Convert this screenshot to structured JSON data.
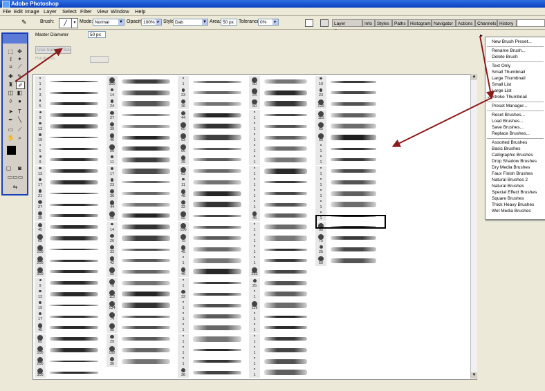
{
  "window": {
    "title": "Adobe Photoshop"
  },
  "menubar": {
    "items": [
      "File",
      "Edit",
      "Image",
      "Layer",
      "Select",
      "Filter",
      "View",
      "Window",
      "Help"
    ]
  },
  "options": {
    "brush_label": "Brush:",
    "mode_label": "Mode:",
    "mode_value": "Normal",
    "opacity_label": "Opacity:",
    "opacity_value": "100%",
    "style_label": "Style:",
    "style_value": "Dab",
    "area_label": "Area:",
    "area_value": "50 px",
    "tolerance_label": "Tolerance:",
    "tolerance_value": "0%"
  },
  "palette_well": [
    "Layer Comps",
    "Info",
    "Styles",
    "Paths",
    "Histogram",
    "Navigator",
    "Actions",
    "Channels",
    "History"
  ],
  "brush_panel": {
    "master_diameter_label": "Master Diameter",
    "master_diameter_value": "50 px",
    "use_sample_size_label": "Use Sample Size",
    "hardness_label": "Hardness:"
  },
  "brush_columns": [
    {
      "nums": [
        "1",
        "3",
        "5",
        "9",
        "13",
        "19",
        "5",
        "9",
        "13",
        "17",
        "21",
        "27",
        "35",
        "45",
        "65",
        "100",
        "200",
        "300",
        "9",
        "13",
        "19",
        "17",
        "45",
        "65",
        "100",
        "200",
        "300"
      ]
    },
    {
      "nums": [
        "300",
        "14",
        "24",
        "27",
        "39",
        "46",
        "59",
        "11",
        "17",
        "23",
        "36",
        "44",
        "60",
        "14",
        "26",
        "33",
        "42",
        "55",
        "70",
        "112",
        "134",
        "74",
        "95",
        "29",
        "192",
        "36"
      ]
    },
    {
      "nums": [
        "1",
        "23",
        "36",
        "44",
        "60",
        "63",
        "66",
        "39",
        "63",
        "11",
        "48",
        "32",
        "55",
        "100",
        "75",
        "45",
        "1",
        "46",
        "1",
        "32",
        "1",
        "1",
        "1",
        "1",
        "1",
        "1",
        "36"
      ]
    },
    {
      "nums": [
        "60",
        "54",
        "50",
        "1",
        "1",
        "1",
        "1",
        "1",
        "1",
        "1",
        "1",
        "1",
        "45",
        "1",
        "1",
        "1",
        "1",
        "252",
        "25",
        "1",
        "119",
        "1",
        "1",
        "1",
        "1",
        "1",
        "1"
      ]
    },
    {
      "nums": [
        "10",
        "23",
        "120",
        "110",
        "65",
        "60",
        "1",
        "1",
        "1",
        "1",
        "1",
        "1",
        "1",
        "95",
        "75",
        "25",
        "50"
      ]
    }
  ],
  "brush_menu": {
    "items": [
      "New Brush Preset...",
      "Rename Brush...",
      "Delete Brush",
      "Text Only",
      "Small Thumbnail",
      "Large Thumbnail",
      "Small List",
      "Large List",
      "Stroke Thumbnail",
      "Preset Manager...",
      "Reset Brushes...",
      "Load Brushes...",
      "Save Brushes...",
      "Replace Brushes...",
      "Assorted Brushes",
      "Basic Brushes",
      "Calligraphic Brushes",
      "Drop Shadow Brushes",
      "Dry Media Brushes",
      "Faux Finish Brushes",
      "Natural Brushes 2",
      "Natural Brushes",
      "Special Effect Brushes",
      "Square Brushes",
      "Thick Heavy Brushes",
      "Wet Media Brushes"
    ],
    "checked": "Stroke Thumbnail",
    "checkmark": "✓"
  },
  "colors": {
    "arrow": "#8b1a1a",
    "title_blue": "#0a3fc0",
    "toolbox_border": "#1a3fb8"
  }
}
